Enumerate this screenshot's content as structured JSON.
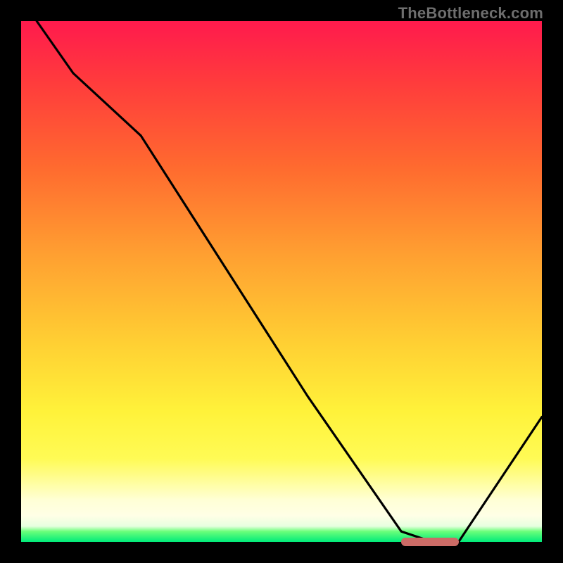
{
  "watermark": "TheBottleneck.com",
  "colors": {
    "background": "#000000",
    "curve": "#000000",
    "marker": "#cc6b66",
    "gradient_top": "#ff1a4d",
    "gradient_bottom": "#00eb7a"
  },
  "chart_data": {
    "type": "line",
    "title": "",
    "xlabel": "",
    "ylabel": "",
    "xlim": [
      0,
      100
    ],
    "ylim": [
      0,
      100
    ],
    "x": [
      3,
      10,
      23,
      55,
      73,
      79,
      84,
      100
    ],
    "values": [
      100,
      90,
      78,
      28,
      2,
      0,
      0,
      24
    ],
    "marker": {
      "x_start": 73,
      "x_end": 84,
      "y": 0
    }
  }
}
